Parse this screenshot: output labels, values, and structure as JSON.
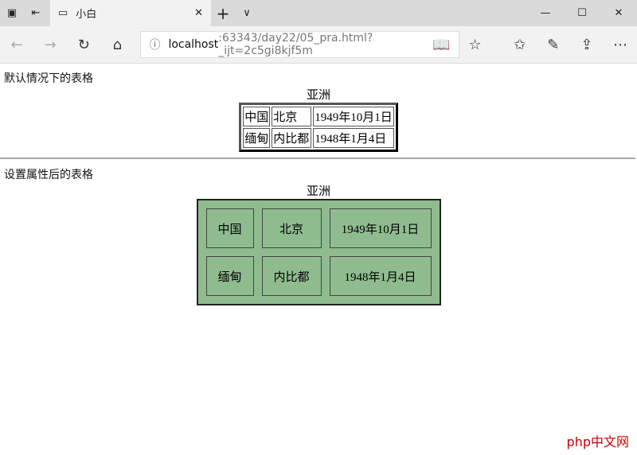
{
  "browser": {
    "tab_title": "小白",
    "url_host": "localhost",
    "url_rest": ":63343/day22/05_pra.html?_ijt=2c5gi8kjf5m"
  },
  "section1": {
    "label": "默认情况下的表格",
    "caption": "亚洲",
    "rows": [
      [
        "中国",
        "北京",
        "1949年10月1日"
      ],
      [
        "缅甸",
        "内比都",
        "1948年1月4日"
      ]
    ]
  },
  "section2": {
    "label": "设置属性后的表格",
    "caption": "亚洲",
    "bg_color": "#8fbc8f",
    "rows": [
      [
        "中国",
        "北京",
        "1949年10月1日"
      ],
      [
        "缅甸",
        "内比都",
        "1948年1月4日"
      ]
    ]
  },
  "watermark": "php中文网"
}
